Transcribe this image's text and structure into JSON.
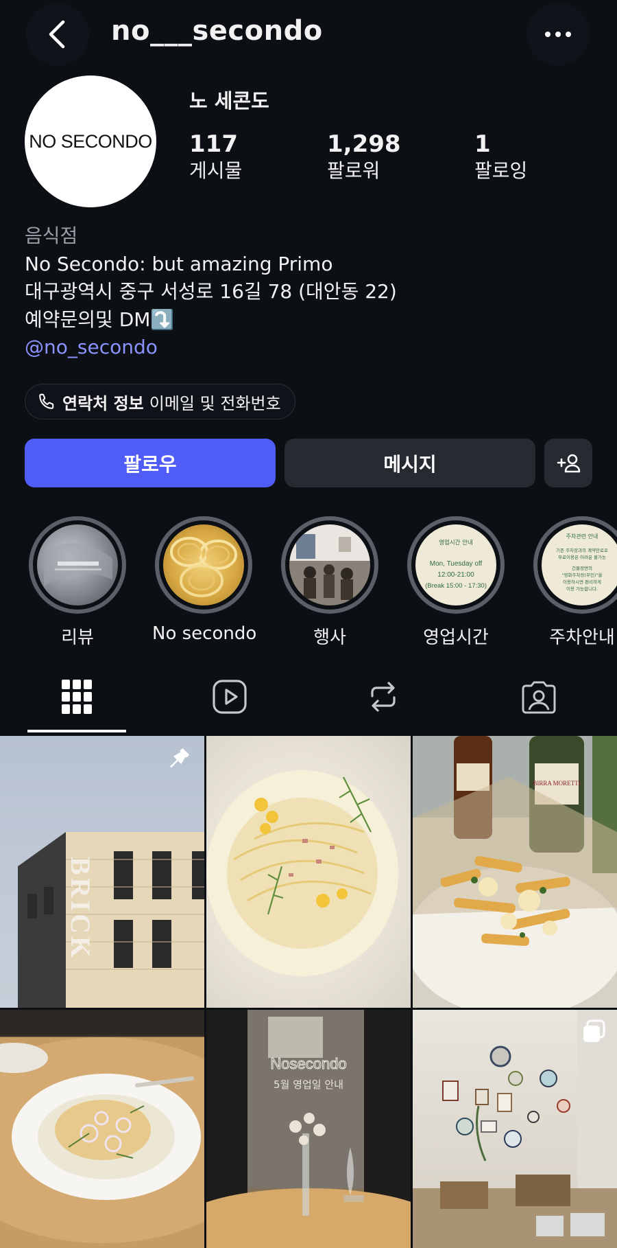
{
  "header": {
    "username": "no___secondo",
    "back_icon": "chevron-left-icon",
    "more_icon": "more-horizontal-icon"
  },
  "profile": {
    "avatar_text": "NO SECONDO",
    "display_name": "노 세콘도",
    "stats": [
      {
        "value": "117",
        "label": "게시물"
      },
      {
        "value": "1,298",
        "label": "팔로워"
      },
      {
        "value": "1",
        "label": "팔로잉"
      }
    ]
  },
  "bio": {
    "category": "음식점",
    "line1": "No Secondo: but amazing Primo",
    "line2": "대구광역시 중구 서성로 16길 78 (대안동 22)",
    "line3": "예약문의및 DM",
    "line3_emoji": "⤵️",
    "link": "@no_secondo"
  },
  "contact": {
    "icon": "phone-icon",
    "strong": "연락처 정보",
    "rest": "이메일 및 전화번호"
  },
  "actions": {
    "follow": "팔로우",
    "message": "메시지",
    "add_user_icon": "add-user-icon",
    "follow_color": "#4f5df6"
  },
  "highlights": [
    {
      "label": "리뷰"
    },
    {
      "label": "No secondo"
    },
    {
      "label": "행사"
    },
    {
      "label": "영업시간",
      "card_title": "영업시간 안내",
      "card_lines": [
        "Mon, Tuesday off",
        "12:00-21:00",
        "(Break 15:00 - 17:30)"
      ]
    },
    {
      "label": "주차안내",
      "card_title": "주차관련 안내",
      "card_lines": [
        "기존 주차장과의 계약만료로",
        "무료이용은 어려운 불가능",
        "건물정면의",
        "\"영화주차장(무인)\"을",
        "이용하시면 편리하게",
        "이용 가능합니다."
      ]
    }
  ],
  "tabs": [
    {
      "name": "grid",
      "icon": "grid-icon",
      "selected": true
    },
    {
      "name": "reels",
      "icon": "reels-icon",
      "selected": false
    },
    {
      "name": "reposts",
      "icon": "repost-icon",
      "selected": false
    },
    {
      "name": "tagged",
      "icon": "tagged-person-icon",
      "selected": false
    }
  ],
  "posts": [
    {
      "kind": "building",
      "sign": "BRICK",
      "badge_icon": "pin-icon"
    },
    {
      "kind": "pasta-dill"
    },
    {
      "kind": "fries-beer",
      "bottle_label": "BIRRA MORETTI"
    },
    {
      "kind": "pasta-bowl"
    },
    {
      "kind": "notice",
      "title": "Nosecondo",
      "subtitle": "5월 영업일 안내"
    },
    {
      "kind": "interior",
      "badge_icon": "carousel-icon"
    }
  ]
}
